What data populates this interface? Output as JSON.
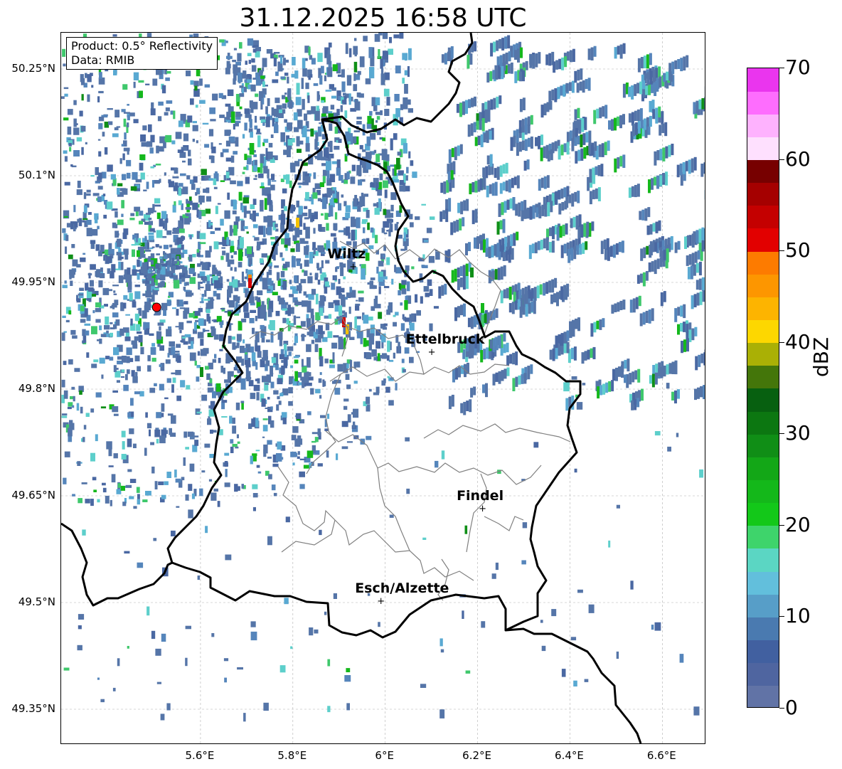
{
  "title": "31.12.2025 16:58 UTC",
  "info": {
    "product": "Product: 0.5° Reflectivity",
    "data": "Data: RMIB"
  },
  "extent": {
    "lon_min": 5.4,
    "lon_max": 6.8,
    "lat_min": 49.3,
    "lat_max": 50.3
  },
  "lat_ticks": [
    "50.25°N",
    "50.1°N",
    "49.95°N",
    "49.8°N",
    "49.65°N",
    "49.5°N",
    "49.35°N"
  ],
  "lat_values": [
    50.25,
    50.1,
    49.95,
    49.8,
    49.65,
    49.5,
    49.35
  ],
  "lon_ticks": [
    "5.6°E",
    "5.8°E",
    "6°E",
    "6.2°E",
    "6.4°E",
    "6.6°E"
  ],
  "lon_values": [
    5.6,
    5.8,
    6.0,
    6.2,
    6.4,
    6.6
  ],
  "cities": [
    {
      "name": "Wiltz",
      "lon": 5.93,
      "lat": 49.97
    },
    {
      "name": "Ettelbruck",
      "lon": 6.1,
      "lat": 49.85
    },
    {
      "name": "Findel",
      "lon": 6.21,
      "lat": 49.63
    },
    {
      "name": "Esch/Alzette",
      "lon": 5.99,
      "lat": 49.5
    }
  ],
  "radar_site": {
    "lon": 5.505,
    "lat": 49.915,
    "color": "#ff0000"
  },
  "colorbar": {
    "label": "dBZ",
    "min": 0,
    "max": 70,
    "ticks": [
      "0",
      "10",
      "20",
      "30",
      "40",
      "50",
      "60",
      "70"
    ],
    "tick_values": [
      0,
      10,
      20,
      30,
      40,
      50,
      60,
      70
    ],
    "colors": [
      "#6173a6",
      "#4f65a0",
      "#4160a0",
      "#4a7ab0",
      "#579ec8",
      "#62bfdc",
      "#5bd6c3",
      "#3ed46b",
      "#13c819",
      "#14b81a",
      "#13a717",
      "#108e16",
      "#0c7711",
      "#076010",
      "#44760a",
      "#aab005",
      "#fdd700",
      "#fdb400",
      "#fd9600",
      "#fd7b00",
      "#e20000",
      "#c40000",
      "#a50000",
      "#770000",
      "#fee0fe",
      "#feb2fe",
      "#fe6dfe",
      "#ea35ee"
    ]
  },
  "echo_colors": [
    "#5575a8",
    "#4a68a2",
    "#5585bb",
    "#59a9d2",
    "#5dcfcb",
    "#3fc86c",
    "#15b81c",
    "#0f8f17",
    "#a8b405",
    "#f5c200",
    "#fd8a00",
    "#d20000"
  ]
}
